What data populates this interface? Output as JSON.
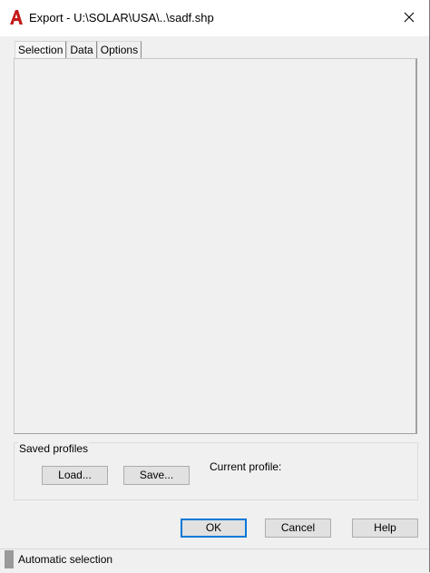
{
  "window": {
    "title": "Export - U:\\SOLAR\\USA\\..\\sadf.shp",
    "app_icon": "autocad-a-icon",
    "close_icon": "close-icon"
  },
  "tabs": [
    {
      "label": "Selection",
      "active": true
    },
    {
      "label": "Data",
      "active": false
    },
    {
      "label": "Options",
      "active": false
    }
  ],
  "profiles": {
    "group_label": "Saved profiles",
    "load_label": "Load...",
    "save_label": "Save...",
    "current_profile_label": "Current profile:"
  },
  "buttons": {
    "ok_label": "OK",
    "cancel_label": "Cancel",
    "help_label": "Help"
  },
  "status": {
    "text": "Automatic selection"
  },
  "colors": {
    "accent": "#0078d7",
    "app_icon": "#c41a1a"
  }
}
